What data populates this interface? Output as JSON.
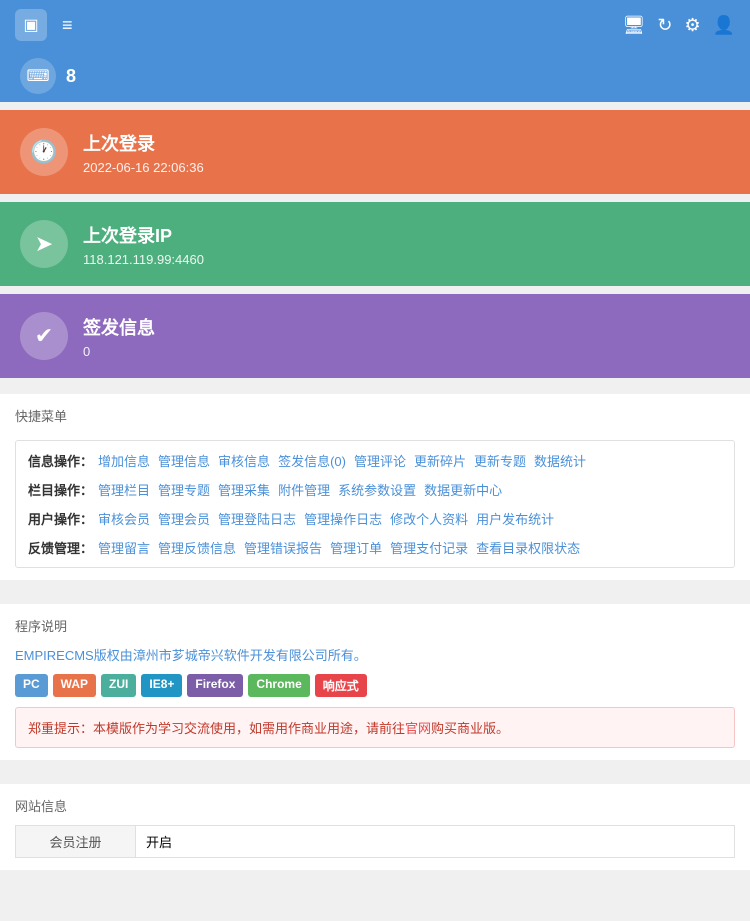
{
  "header": {
    "logo_icon": "▣",
    "menu_icon": "≡",
    "monitor_icon": "⬜",
    "refresh_icon": "↻",
    "settings_icon": "⚙",
    "user_icon": "👤"
  },
  "top_card": {
    "icon": "⌨",
    "value": "8"
  },
  "cards": [
    {
      "id": "last-login",
      "color": "orange",
      "icon": "🕐",
      "title": "上次登录",
      "subtitle": "2022-06-16 22:06:36"
    },
    {
      "id": "last-ip",
      "color": "green",
      "icon": "➤",
      "title": "上次登录IP",
      "subtitle": "118.121.119.99:4460"
    },
    {
      "id": "sign-info",
      "color": "purple",
      "icon": "✔",
      "title": "签发信息",
      "subtitle": "0"
    }
  ],
  "quick_menu": {
    "section_title": "快捷菜单",
    "rows": [
      {
        "category": "信息操作：",
        "links": [
          "增加信息",
          "管理信息",
          "审核信息",
          "签发信息(0)",
          "管理评论",
          "更新碎片",
          "更新专题",
          "数据统计"
        ]
      },
      {
        "category": "栏目操作：",
        "links": [
          "管理栏目",
          "管理专题",
          "管理采集",
          "附件管理",
          "系统参数设置",
          "数据更新中心"
        ]
      },
      {
        "category": "用户操作：",
        "links": [
          "审核会员",
          "管理会员",
          "管理登陆日志",
          "管理操作日志",
          "修改个人资料",
          "用户发布统计"
        ]
      },
      {
        "category": "反馈管理：",
        "links": [
          "管理留言",
          "管理反馈信息",
          "管理错误报告",
          "管理订单",
          "管理支付记录",
          "查看目录权限状态"
        ]
      }
    ]
  },
  "program_section": {
    "title": "程序说明",
    "copyright": "EMPIRECMS版权由漳州市芗城帝兴软件开发有限公司所有。",
    "tags": [
      {
        "label": "PC",
        "color": "blue"
      },
      {
        "label": "WAP",
        "color": "orange"
      },
      {
        "label": "ZUI",
        "color": "teal"
      },
      {
        "label": "IE8+",
        "color": "cyan"
      },
      {
        "label": "Firefox",
        "color": "purple"
      },
      {
        "label": "Chrome",
        "color": "green"
      },
      {
        "label": "响应式",
        "color": "red"
      }
    ],
    "warning": "郑重提示：本模版作为学习交流使用，如需用作商业用途，请前往官网购买商业版。"
  },
  "website_section": {
    "title": "网站信息",
    "rows": [
      {
        "label": "会员注册",
        "value": "开启"
      }
    ]
  }
}
